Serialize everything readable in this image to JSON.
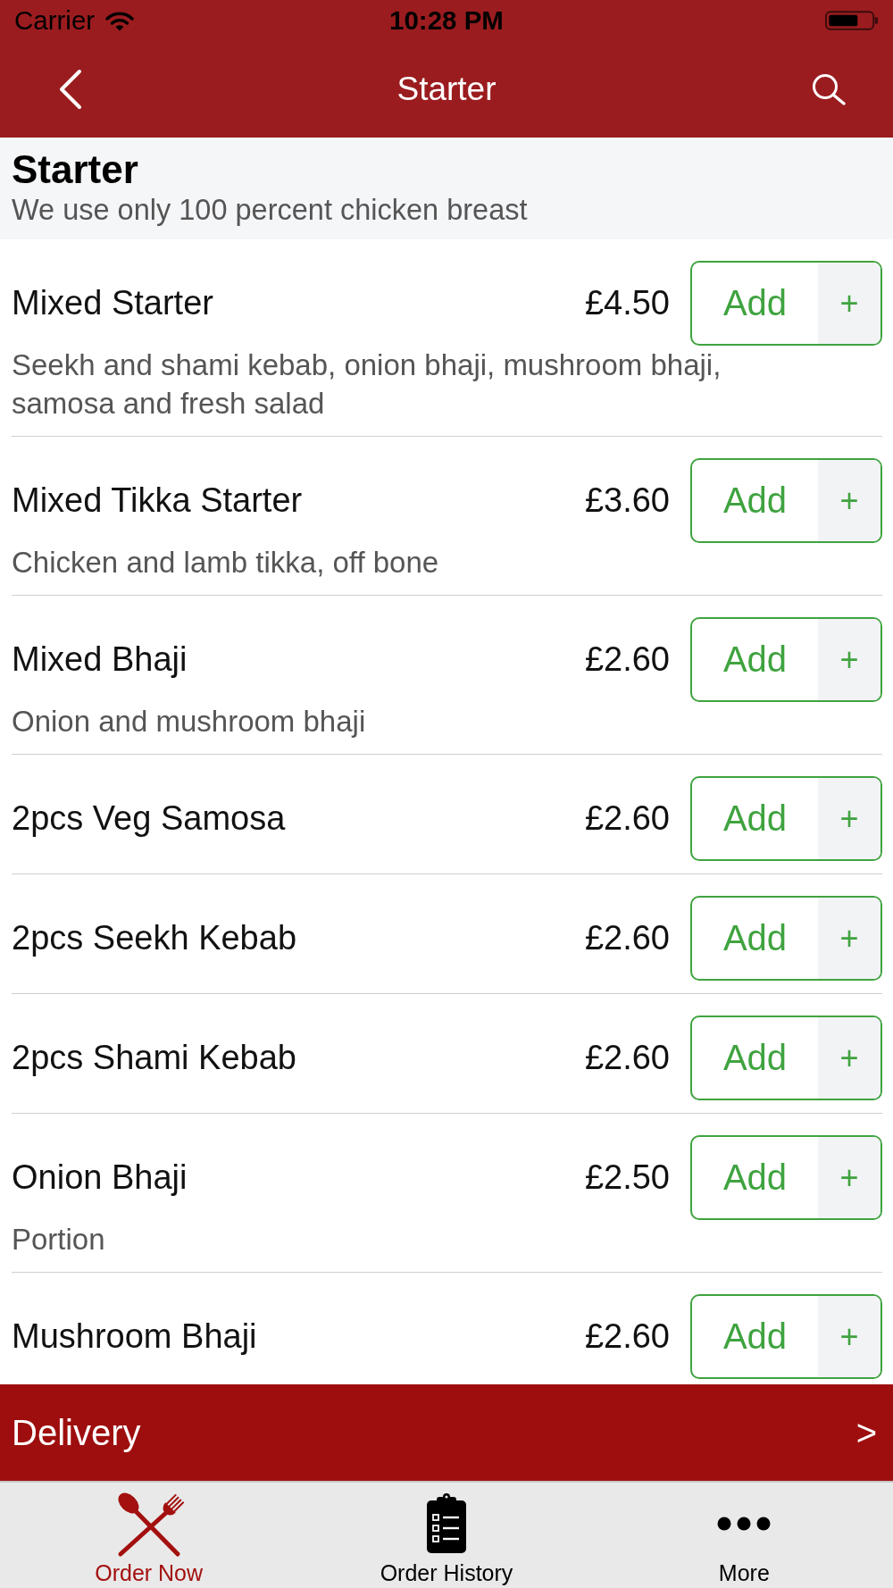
{
  "status_bar": {
    "carrier": "Carrier",
    "time": "10:28 PM"
  },
  "nav_bar": {
    "title": "Starter"
  },
  "category": {
    "title": "Starter",
    "subtitle": "We use only 100 percent chicken breast"
  },
  "menu_items": [
    {
      "name": "Mixed Starter",
      "price": "£4.50",
      "description": "Seekh and shami kebab, onion bhaji, mushroom bhaji, samosa and fresh salad",
      "add_label": "Add",
      "add_symbol": "+"
    },
    {
      "name": "Mixed Tikka Starter",
      "price": "£3.60",
      "description": "Chicken and lamb tikka, off bone",
      "add_label": "Add",
      "add_symbol": "+"
    },
    {
      "name": "Mixed Bhaji",
      "price": "£2.60",
      "description": "Onion and mushroom bhaji",
      "add_label": "Add",
      "add_symbol": "+"
    },
    {
      "name": "2pcs Veg Samosa",
      "price": "£2.60",
      "add_label": "Add",
      "add_symbol": "+"
    },
    {
      "name": "2pcs Seekh Kebab",
      "price": "£2.60",
      "add_label": "Add",
      "add_symbol": "+"
    },
    {
      "name": "2pcs Shami Kebab",
      "price": "£2.60",
      "add_label": "Add",
      "add_symbol": "+"
    },
    {
      "name": "Onion Bhaji",
      "price": "£2.50",
      "description": "Portion",
      "add_label": "Add",
      "add_symbol": "+"
    },
    {
      "name": "Mushroom Bhaji",
      "price": "£2.60",
      "add_label": "Add",
      "add_symbol": "+"
    }
  ],
  "delivery_bar": {
    "label": "Delivery",
    "arrow": ">"
  },
  "tab_bar": [
    {
      "label": "Order Now",
      "selected": true
    },
    {
      "label": "Order History",
      "selected": false
    },
    {
      "label": "More",
      "selected": false
    }
  ]
}
